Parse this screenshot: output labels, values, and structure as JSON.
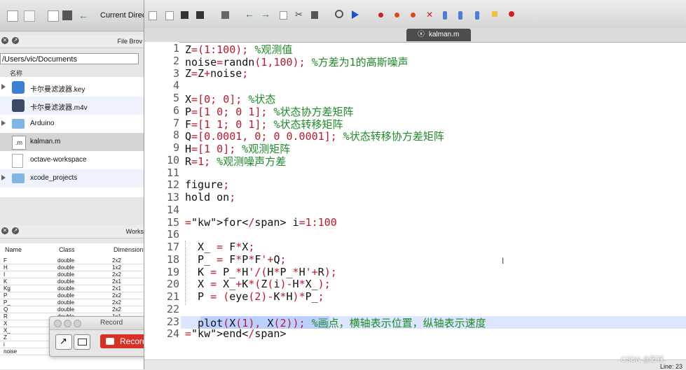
{
  "main_toolbar": {
    "current_directory_label": "Current Direct"
  },
  "file_browser": {
    "title": "File Brov",
    "path": "/Users/vic/Documents",
    "column_name": "名称",
    "items": [
      {
        "name": "卡尔曼滤波器.key",
        "icon": "keynote-icon",
        "expandable": true
      },
      {
        "name": "卡尔曼滤波器.m4v",
        "icon": "quicktime-icon",
        "expandable": false
      },
      {
        "name": "Arduino",
        "icon": "folder-icon",
        "expandable": true
      },
      {
        "name": "kalman.m",
        "icon": "m-file-icon",
        "expandable": false,
        "selected": true
      },
      {
        "name": "octave-workspace",
        "icon": "document-icon",
        "expandable": false
      },
      {
        "name": "xcode_projects",
        "icon": "folder-icon",
        "expandable": true
      }
    ]
  },
  "workspace": {
    "title": "Works",
    "columns": [
      "Name",
      "Class",
      "Dimension"
    ],
    "rows": [
      {
        "name": "F",
        "class": "double",
        "dim": "2x2"
      },
      {
        "name": "H",
        "class": "double",
        "dim": "1x2"
      },
      {
        "name": "I",
        "class": "double",
        "dim": "2x2"
      },
      {
        "name": "K",
        "class": "double",
        "dim": "2x1"
      },
      {
        "name": "Kg",
        "class": "double",
        "dim": "2x1"
      },
      {
        "name": "P",
        "class": "double",
        "dim": "2x2"
      },
      {
        "name": "P_",
        "class": "double",
        "dim": "2x2"
      },
      {
        "name": "Q",
        "class": "double",
        "dim": "2x2"
      },
      {
        "name": "R",
        "class": "double",
        "dim": "1x1"
      },
      {
        "name": "X",
        "class": "",
        "dim": ""
      },
      {
        "name": "X_",
        "class": "",
        "dim": ""
      },
      {
        "name": "Z",
        "class": "",
        "dim": ""
      },
      {
        "name": "i",
        "class": "",
        "dim": ""
      },
      {
        "name": "noise",
        "class": "",
        "dim": ""
      }
    ]
  },
  "record_dialog": {
    "title": "Record",
    "record_label": "Record"
  },
  "editor": {
    "tab_label": "kalman.m",
    "line_numbers": [
      "1",
      "2",
      "3",
      "4",
      "5",
      "6",
      "7",
      "8",
      "9",
      "10",
      "11",
      "12",
      "13",
      "14",
      "15",
      "16",
      "17",
      "18",
      "19",
      "20",
      "21",
      "22",
      "23",
      "24"
    ],
    "lines": [
      "Z=(1:100); %观测值",
      "noise=randn(1,100); %方差为1的高斯噪声",
      "Z=Z+noise;",
      "",
      "X=[0; 0]; %状态",
      "P=[1 0; 0 1]; %状态协方差矩阵",
      "F=[1 1; 0 1]; %状态转移矩阵",
      "Q=[0.0001, 0; 0 0.0001]; %状态转移协方差矩阵",
      "H=[1 0]; %观测矩阵",
      "R=1; %观测噪声方差",
      "",
      "figure;",
      "hold on;",
      "",
      "for i=1:100",
      "",
      "  X_ = F*X;",
      "  P_ = F*P*F'+Q;",
      "  K = P_*H'/(H*P_*H'+R);",
      "  X = X_+K*(Z(i)-H*X_);",
      "  P = (eye(2)-K*H)*P_;",
      "",
      "  plot(X(1), X(2)); %画点，横轴表示位置，纵轴表示速度",
      "end"
    ],
    "status_line": "Line: 23"
  },
  "watermark": "CSDN @彭祥."
}
